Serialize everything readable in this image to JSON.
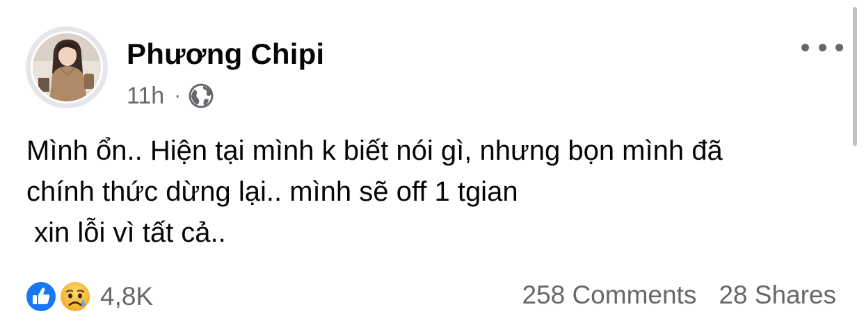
{
  "post": {
    "author": "Phương Chipi",
    "time": "11h",
    "separator": "·",
    "privacy_icon": "globe-icon",
    "more_icon": "more-options-icon",
    "text_lines": [
      "Mình ổn.. Hiện tại mình k biết nói gì, nhưng bọn mình đã",
      "chính thức dừng lại.. mình sẽ off 1 tgian",
      " xin lỗi vì tất cả.."
    ]
  },
  "reactions": {
    "icons": [
      "like-icon",
      "sad-icon"
    ],
    "count": "4,8K"
  },
  "stats": {
    "comments": "258 Comments",
    "shares": "28 Shares"
  },
  "colors": {
    "text_primary": "#050505",
    "text_secondary": "#65676b",
    "like_blue": "#1877f2",
    "sad_yellow": "#f7b125"
  }
}
